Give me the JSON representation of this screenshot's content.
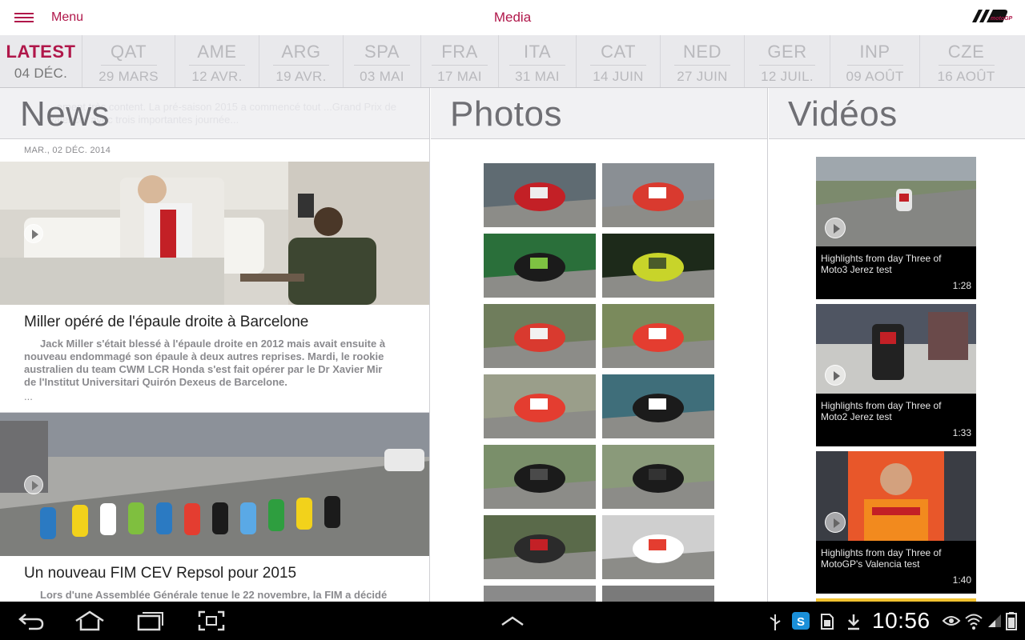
{
  "topbar": {
    "menu_label": "Menu",
    "title": "Media",
    "accent_color": "#b0174a"
  },
  "rounds": [
    {
      "code": "LATEST",
      "date": "04 DÉC.",
      "active": true
    },
    {
      "code": "QAT",
      "date": "29 MARS"
    },
    {
      "code": "AME",
      "date": "12 AVR."
    },
    {
      "code": "ARG",
      "date": "19 AVR."
    },
    {
      "code": "SPA",
      "date": "03 MAI"
    },
    {
      "code": "FRA",
      "date": "17 MAI"
    },
    {
      "code": "ITA",
      "date": "31 MAI"
    },
    {
      "code": "CAT",
      "date": "14 JUIN"
    },
    {
      "code": "NED",
      "date": "27 JUIN"
    },
    {
      "code": "GER",
      "date": "12 JUIL."
    },
    {
      "code": "INP",
      "date": "09 AOÛT"
    },
    {
      "code": "CZE",
      "date": "16 AOÛT"
    }
  ],
  "news": {
    "heading": "News",
    "ghost_text": "...ement très content. La pré-saison 2015 a commencé tout ...Grand Prix de Valence, avec trois importantes journée...",
    "date": "MAR., 02 DÉC. 2014",
    "items": [
      {
        "title": "Miller opéré de l'épaule droite à Barcelone",
        "body": "Jack Miller s'était blessé à l'épaule droite en 2012 mais avait ensuite à nouveau endommagé son épaule à deux autres reprises. Mardi, le rookie australien du team CWM LCR Honda s'est fait opérer par le Dr Xavier Mir de l'Institut Universitari Quirón Dexeus de Barcelone.",
        "ellipsis": "..."
      },
      {
        "title": "Un nouveau FIM CEV Repsol pour 2015",
        "body": "Lors d'une Assemblée Générale tenue le 22 novembre, la FIM a décidé"
      }
    ]
  },
  "photos": {
    "heading": "Photos",
    "count": 14
  },
  "videos": {
    "heading": "Vidéos",
    "items": [
      {
        "title": "Highlights from day Three of Moto3 Jerez test",
        "duration": "1:28"
      },
      {
        "title": "Highlights from day Three of Moto2 Jerez test",
        "duration": "1:33"
      },
      {
        "title": "Highlights from day Three of MotoGP's Valencia test",
        "duration": "1:40"
      }
    ]
  },
  "statusbar": {
    "time": "10:56",
    "icons": [
      "back-icon",
      "home-icon",
      "recent-apps-icon",
      "screenshot-icon",
      "up-chevron-icon",
      "usb-icon",
      "skype-icon",
      "sd-card-icon",
      "download-icon",
      "eye-icon",
      "wifi-icon",
      "signal-icon",
      "battery-icon"
    ]
  }
}
